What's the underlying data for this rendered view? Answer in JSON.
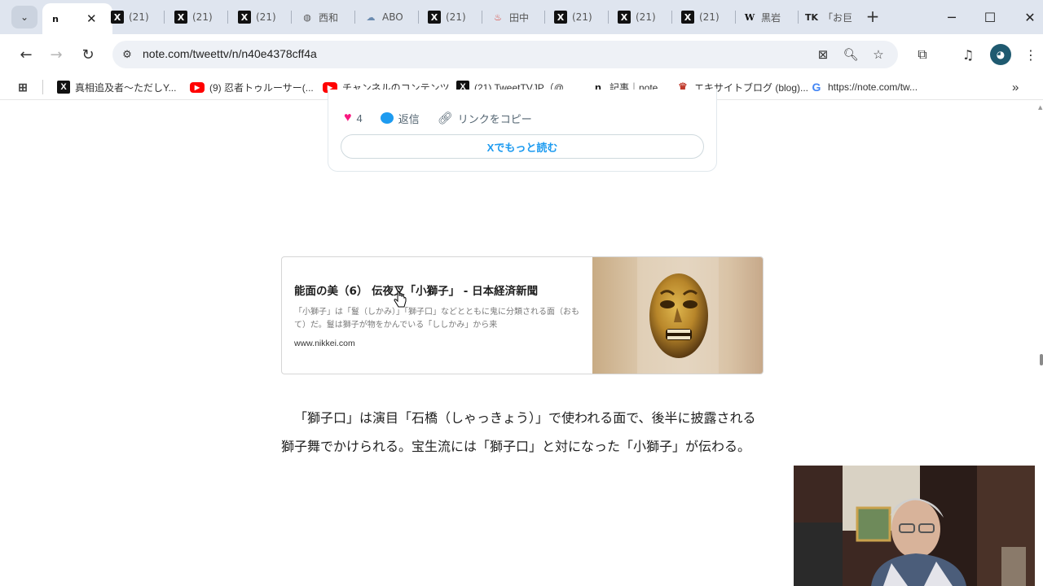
{
  "tabs": [
    {
      "label": "",
      "favicon": "note",
      "active": true
    },
    {
      "label": "(21)",
      "favicon": "x"
    },
    {
      "label": "(21)",
      "favicon": "x"
    },
    {
      "label": "(21)",
      "favicon": "x"
    },
    {
      "label": "西和",
      "favicon": "globe"
    },
    {
      "label": "ABO",
      "favicon": "rain"
    },
    {
      "label": "(21)",
      "favicon": "x"
    },
    {
      "label": "田中",
      "favicon": "red"
    },
    {
      "label": "(21)",
      "favicon": "x"
    },
    {
      "label": "(21)",
      "favicon": "x"
    },
    {
      "label": "(21)",
      "favicon": "x"
    },
    {
      "label": "黒岩",
      "favicon": "wikipedia"
    },
    {
      "label": "「お巨",
      "favicon": "tk"
    }
  ],
  "toolbar": {
    "url": "note.com/tweettv/n/n40e4378cff4a"
  },
  "bookmarks": [
    {
      "label": "真相追及者～ただしY...",
      "favicon": "x"
    },
    {
      "label": "(9) 忍者トゥルーサー(...",
      "favicon": "youtube"
    },
    {
      "label": "チャンネルのコンテンツ...",
      "favicon": "youtube"
    },
    {
      "label": "(21) TweetTVJP（@...",
      "favicon": "x"
    },
    {
      "label": "記事｜note",
      "favicon": "note"
    },
    {
      "label": "エキサイトブログ (blog)...",
      "favicon": "excite"
    },
    {
      "label": "https://note.com/tw...",
      "favicon": "google"
    }
  ],
  "tweet": {
    "like_count": "4",
    "reply_label": "返信",
    "copy_link_label": "リンクをコピー",
    "read_more_label": "Xでもっと読む"
  },
  "link_card": {
    "title": "能面の美（6） 伝夜叉「小獅子」 - 日本経済新聞",
    "description": "「小獅子」は「鬘（しかみ）」「獅子口」などとともに鬼に分類される面（おもて）だ。鬘は獅子が物をかんでいる「ししかみ」から来",
    "domain": "www.nikkei.com"
  },
  "article": {
    "paragraph": "「獅子口」は演目「石橋（しゃっきょう）」で使われる面で、後半に披露される獅子舞でかけられる。宝生流には「獅子口」と対になった「小獅子」が伝わる。"
  },
  "colors": {
    "tabstrip": "#dfe5ef",
    "x_blue": "#1d9bf0",
    "like_pink": "#f91880"
  }
}
